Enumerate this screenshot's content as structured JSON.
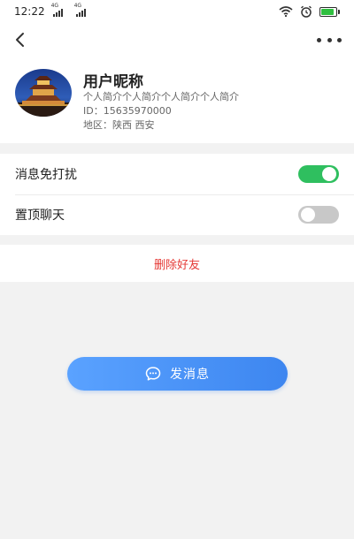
{
  "status": {
    "time": "12:22",
    "sim1_tag": "4G",
    "sim2_tag": "4G"
  },
  "nav": {
    "back_icon": "chevron-left-icon",
    "more_icon": "more-dots-icon"
  },
  "profile": {
    "nickname": "用户昵称",
    "bio": "个人简介个人简介个人简介个人简介",
    "id_text": "ID：15635970000",
    "region_text": "地区：陕西  西安"
  },
  "settings": {
    "mute_label": "消息免打扰",
    "mute_on": true,
    "pin_label": "置顶聊天",
    "pin_on": false
  },
  "actions": {
    "delete_label": "删除好友",
    "send_label": "发消息"
  },
  "colors": {
    "toggle_on": "#2fbf5f",
    "danger": "#e53935",
    "primary": "#3d86f0"
  }
}
